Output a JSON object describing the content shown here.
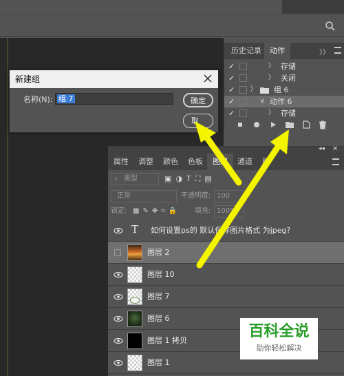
{
  "colors": {
    "panel": "#535353",
    "tab_strip": "#424242",
    "canvas": "#282828",
    "selection": "#3a7bd5",
    "arrow": "#f4f400",
    "watermark_green": "#2a9d2a"
  },
  "history_panel": {
    "tabs": [
      "历史记录",
      "动作"
    ],
    "active_tab": "动作",
    "rows": [
      {
        "label": "存储",
        "expander": "〉"
      },
      {
        "label": "关闭",
        "expander": "〉"
      },
      {
        "label": "组 6",
        "expander": "〉",
        "is_folder": true
      },
      {
        "label": "动作 6",
        "expander": "∨",
        "selected": true
      },
      {
        "label": "存储",
        "expander": "〉"
      }
    ]
  },
  "dialog": {
    "title": "新建组",
    "name_label": "名称(N):",
    "name_value": "组 7",
    "ok_label": "确定",
    "cancel_label": "取"
  },
  "layers_panel": {
    "tabs": [
      "属性",
      "调整",
      "颜色",
      "色板",
      "图层",
      "通道",
      "路"
    ],
    "active_tab": "图层",
    "filter_label": "类型",
    "blend_mode": "正常",
    "opacity_label": "不透明度:",
    "opacity_value": "100",
    "lock_label": "锁定:",
    "fill_label": "填充:",
    "fill_value": "100%",
    "layers": [
      {
        "name": "如何设置ps的 默认保存图片格式 为jpeg?",
        "type": "text",
        "visible": true
      },
      {
        "name": "图层 2",
        "type": "photo",
        "visible": false,
        "selected": true
      },
      {
        "name": "图层 10",
        "type": "checker",
        "visible": true
      },
      {
        "name": "图层 7",
        "type": "flower",
        "visible": true
      },
      {
        "name": "图层 6",
        "type": "green",
        "visible": true
      },
      {
        "name": "图层 1 拷贝",
        "type": "black",
        "visible": true
      },
      {
        "name": "图层 1",
        "type": "checker",
        "visible": true
      }
    ]
  },
  "watermark": {
    "title": "百科全说",
    "subtitle": "助你轻松解决"
  }
}
